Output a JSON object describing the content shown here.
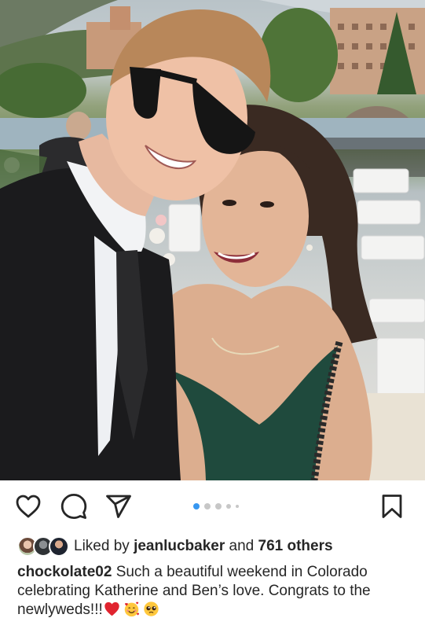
{
  "post": {
    "photo_alt": "",
    "carousel": {
      "count": 5,
      "active_index": 0
    }
  },
  "actions": {
    "like_icon": "heart-outline-icon",
    "comment_icon": "comment-bubble-icon",
    "share_icon": "paper-plane-icon",
    "save_icon": "bookmark-outline-icon"
  },
  "likes": {
    "prefix": "Liked by",
    "user": "jeanlucbaker",
    "middle": "and",
    "others": "761 others"
  },
  "caption": {
    "username": "chockolate02",
    "text": "Such a beautiful weekend in Colorado celebrating Katherine and Ben’s love. Congrats to the newlyweds!!!",
    "emojis": [
      "red-heart-emoji",
      "smiling-face-with-hearts-emoji",
      "pleading-face-emoji"
    ]
  },
  "colors": {
    "accent_blue": "#3797f0",
    "text": "#262626",
    "dot_inactive": "#c7c7c7",
    "heart_red": "#e0242f"
  }
}
